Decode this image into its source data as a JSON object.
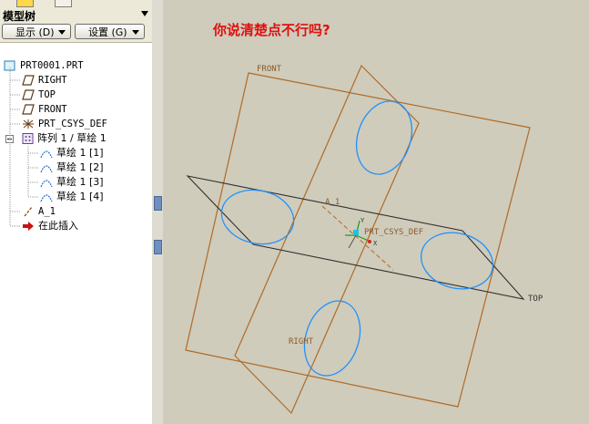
{
  "panel": {
    "title": "模型树"
  },
  "buttons": {
    "display": "显示 (D)",
    "settings": "设置 (G)"
  },
  "tree": {
    "root": "PRT0001.PRT",
    "right": "RIGHT",
    "top": "TOP",
    "front": "FRONT",
    "csys": "PRT_CSYS_DEF",
    "pattern": "阵列 1 / 草绘 1",
    "sketches": [
      "草绘 1 [1]",
      "草绘 1 [2]",
      "草绘 1 [3]",
      "草绘 1 [4]"
    ],
    "axis": "A_1",
    "insert": "在此插入"
  },
  "viewport": {
    "annotation": "你说清楚点不行吗?",
    "labels": {
      "front": "FRONT",
      "top": "TOP",
      "right": "RIGHT",
      "axis": "A_1",
      "csys": "PRT_CSYS_DEF",
      "csys_x": "X",
      "csys_y": "Y"
    }
  },
  "colors": {
    "datum_plane": "#b06a28",
    "top_plane": "#303030",
    "sketch": "#1e90ff",
    "annotation": "#e01010",
    "insert_arrow": "#cc1111",
    "pattern_icon": "#6a3d9a"
  },
  "icons": [
    "part-icon",
    "datum-plane-icon",
    "csys-icon",
    "expand-icon",
    "pattern-icon",
    "sketch-icon",
    "axis-icon",
    "insert-arrow-icon"
  ]
}
